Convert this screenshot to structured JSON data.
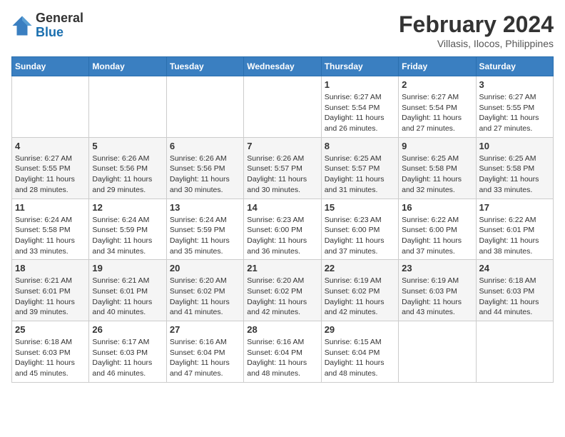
{
  "header": {
    "logo": {
      "general": "General",
      "blue": "Blue"
    },
    "month": "February 2024",
    "location": "Villasis, Ilocos, Philippines"
  },
  "days_of_week": [
    "Sunday",
    "Monday",
    "Tuesday",
    "Wednesday",
    "Thursday",
    "Friday",
    "Saturday"
  ],
  "weeks": [
    [
      {
        "day": "",
        "info": ""
      },
      {
        "day": "",
        "info": ""
      },
      {
        "day": "",
        "info": ""
      },
      {
        "day": "",
        "info": ""
      },
      {
        "day": "1",
        "info": "Sunrise: 6:27 AM\nSunset: 5:54 PM\nDaylight: 11 hours and 26 minutes."
      },
      {
        "day": "2",
        "info": "Sunrise: 6:27 AM\nSunset: 5:54 PM\nDaylight: 11 hours and 27 minutes."
      },
      {
        "day": "3",
        "info": "Sunrise: 6:27 AM\nSunset: 5:55 PM\nDaylight: 11 hours and 27 minutes."
      }
    ],
    [
      {
        "day": "4",
        "info": "Sunrise: 6:27 AM\nSunset: 5:55 PM\nDaylight: 11 hours and 28 minutes."
      },
      {
        "day": "5",
        "info": "Sunrise: 6:26 AM\nSunset: 5:56 PM\nDaylight: 11 hours and 29 minutes."
      },
      {
        "day": "6",
        "info": "Sunrise: 6:26 AM\nSunset: 5:56 PM\nDaylight: 11 hours and 30 minutes."
      },
      {
        "day": "7",
        "info": "Sunrise: 6:26 AM\nSunset: 5:57 PM\nDaylight: 11 hours and 30 minutes."
      },
      {
        "day": "8",
        "info": "Sunrise: 6:25 AM\nSunset: 5:57 PM\nDaylight: 11 hours and 31 minutes."
      },
      {
        "day": "9",
        "info": "Sunrise: 6:25 AM\nSunset: 5:58 PM\nDaylight: 11 hours and 32 minutes."
      },
      {
        "day": "10",
        "info": "Sunrise: 6:25 AM\nSunset: 5:58 PM\nDaylight: 11 hours and 33 minutes."
      }
    ],
    [
      {
        "day": "11",
        "info": "Sunrise: 6:24 AM\nSunset: 5:58 PM\nDaylight: 11 hours and 33 minutes."
      },
      {
        "day": "12",
        "info": "Sunrise: 6:24 AM\nSunset: 5:59 PM\nDaylight: 11 hours and 34 minutes."
      },
      {
        "day": "13",
        "info": "Sunrise: 6:24 AM\nSunset: 5:59 PM\nDaylight: 11 hours and 35 minutes."
      },
      {
        "day": "14",
        "info": "Sunrise: 6:23 AM\nSunset: 6:00 PM\nDaylight: 11 hours and 36 minutes."
      },
      {
        "day": "15",
        "info": "Sunrise: 6:23 AM\nSunset: 6:00 PM\nDaylight: 11 hours and 37 minutes."
      },
      {
        "day": "16",
        "info": "Sunrise: 6:22 AM\nSunset: 6:00 PM\nDaylight: 11 hours and 37 minutes."
      },
      {
        "day": "17",
        "info": "Sunrise: 6:22 AM\nSunset: 6:01 PM\nDaylight: 11 hours and 38 minutes."
      }
    ],
    [
      {
        "day": "18",
        "info": "Sunrise: 6:21 AM\nSunset: 6:01 PM\nDaylight: 11 hours and 39 minutes."
      },
      {
        "day": "19",
        "info": "Sunrise: 6:21 AM\nSunset: 6:01 PM\nDaylight: 11 hours and 40 minutes."
      },
      {
        "day": "20",
        "info": "Sunrise: 6:20 AM\nSunset: 6:02 PM\nDaylight: 11 hours and 41 minutes."
      },
      {
        "day": "21",
        "info": "Sunrise: 6:20 AM\nSunset: 6:02 PM\nDaylight: 11 hours and 42 minutes."
      },
      {
        "day": "22",
        "info": "Sunrise: 6:19 AM\nSunset: 6:02 PM\nDaylight: 11 hours and 42 minutes."
      },
      {
        "day": "23",
        "info": "Sunrise: 6:19 AM\nSunset: 6:03 PM\nDaylight: 11 hours and 43 minutes."
      },
      {
        "day": "24",
        "info": "Sunrise: 6:18 AM\nSunset: 6:03 PM\nDaylight: 11 hours and 44 minutes."
      }
    ],
    [
      {
        "day": "25",
        "info": "Sunrise: 6:18 AM\nSunset: 6:03 PM\nDaylight: 11 hours and 45 minutes."
      },
      {
        "day": "26",
        "info": "Sunrise: 6:17 AM\nSunset: 6:03 PM\nDaylight: 11 hours and 46 minutes."
      },
      {
        "day": "27",
        "info": "Sunrise: 6:16 AM\nSunset: 6:04 PM\nDaylight: 11 hours and 47 minutes."
      },
      {
        "day": "28",
        "info": "Sunrise: 6:16 AM\nSunset: 6:04 PM\nDaylight: 11 hours and 48 minutes."
      },
      {
        "day": "29",
        "info": "Sunrise: 6:15 AM\nSunset: 6:04 PM\nDaylight: 11 hours and 48 minutes."
      },
      {
        "day": "",
        "info": ""
      },
      {
        "day": "",
        "info": ""
      }
    ]
  ]
}
